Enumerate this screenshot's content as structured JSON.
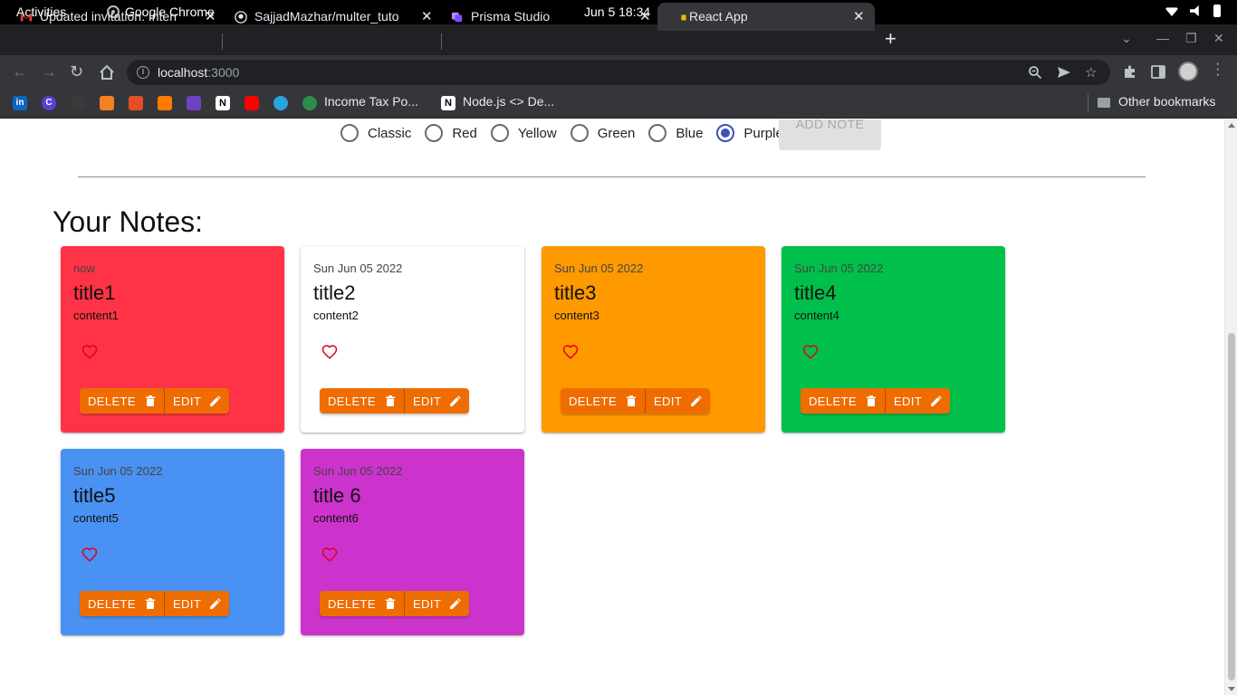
{
  "system_bar": {
    "activities": "Activities",
    "app_name": "Google Chrome",
    "clock": "Jun 5  18:34"
  },
  "tabs": [
    {
      "title": "Updated invitation: Interr",
      "icon": "gmail-icon"
    },
    {
      "title": "SajjadMazhar/multer_tuto",
      "icon": "github-icon"
    },
    {
      "title": "Prisma Studio",
      "icon": "prisma-icon"
    },
    {
      "title": "React App",
      "icon": "react-icon",
      "active": true
    }
  ],
  "omnibox": {
    "host": "localhost",
    "port": ":3000"
  },
  "bookmarks": {
    "items": [
      {
        "label": "Income Tax Po...",
        "icon": "income-tax-icon"
      },
      {
        "label": "Node.js <> De...",
        "icon": "notion-icon"
      }
    ],
    "other": "Other bookmarks"
  },
  "app": {
    "color_options": [
      {
        "label": "Classic",
        "checked": false
      },
      {
        "label": "Red",
        "checked": false
      },
      {
        "label": "Yellow",
        "checked": false
      },
      {
        "label": "Green",
        "checked": false
      },
      {
        "label": "Blue",
        "checked": false
      },
      {
        "label": "Purple",
        "checked": true
      }
    ],
    "add_note_label": "ADD NOTE",
    "heading": "Your Notes:",
    "delete_label": "DELETE",
    "edit_label": "EDIT",
    "notes": [
      {
        "date": "now",
        "title": "title1",
        "content": "content1",
        "color": "#ff3347"
      },
      {
        "date": "Sun Jun 05 2022",
        "title": "title2",
        "content": "content2",
        "color": "#ffffff"
      },
      {
        "date": "Sun Jun 05 2022",
        "title": "title3",
        "content": "content3",
        "color": "#ff9900"
      },
      {
        "date": "Sun Jun 05 2022",
        "title": "title4",
        "content": "content4",
        "color": "#00c04b"
      },
      {
        "date": "Sun Jun 05 2022",
        "title": "title5",
        "content": "content5",
        "color": "#4991f2"
      },
      {
        "date": "Sun Jun 05 2022",
        "title": "title 6",
        "content": "content6",
        "color": "#cc33cc"
      }
    ]
  },
  "colors": {
    "accent_radio": "#3f51b5",
    "button": "#ef6c00",
    "heart": "#e0001b"
  }
}
